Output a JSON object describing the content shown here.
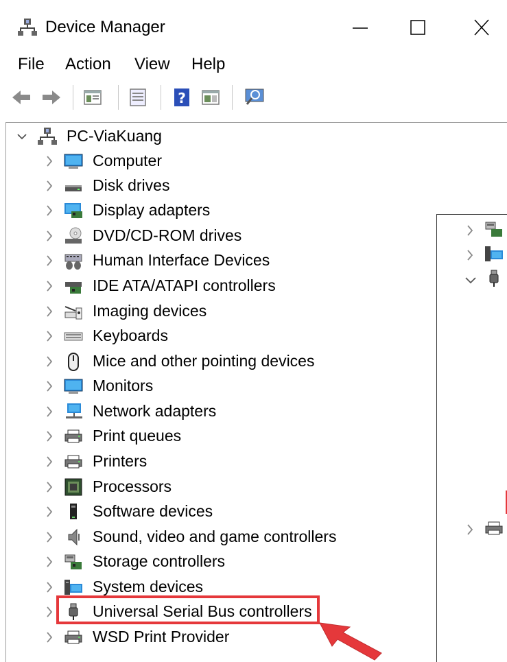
{
  "window": {
    "title": "Device Manager",
    "minimize_glyph": "—",
    "maximize_glyph": "☐",
    "close_glyph": "✕"
  },
  "menu": [
    "File",
    "Action",
    "View",
    "Help"
  ],
  "toolbar": {
    "buttons": [
      "back-icon",
      "forward-icon",
      "show-hide-console-tree-icon",
      "properties-icon",
      "help-icon",
      "action-pane-icon",
      "scan-hardware-icon"
    ]
  },
  "tree": {
    "root": {
      "label": "PC-ViaKuang",
      "icon": "computer-network-icon",
      "expanded": true
    },
    "items": [
      {
        "label": "Computer",
        "icon": "monitor-icon"
      },
      {
        "label": "Disk drives",
        "icon": "disk-drive-icon"
      },
      {
        "label": "Display adapters",
        "icon": "display-adapter-icon"
      },
      {
        "label": "DVD/CD-ROM drives",
        "icon": "dvd-drive-icon"
      },
      {
        "label": "Human Interface Devices",
        "icon": "hid-icon"
      },
      {
        "label": "IDE ATA/ATAPI controllers",
        "icon": "ide-controller-icon"
      },
      {
        "label": "Imaging devices",
        "icon": "imaging-device-icon"
      },
      {
        "label": "Keyboards",
        "icon": "keyboard-icon"
      },
      {
        "label": "Mice and other pointing devices",
        "icon": "mouse-icon"
      },
      {
        "label": "Monitors",
        "icon": "monitor-icon"
      },
      {
        "label": "Network adapters",
        "icon": "network-adapter-icon"
      },
      {
        "label": "Print queues",
        "icon": "printer-icon"
      },
      {
        "label": "Printers",
        "icon": "printer-icon"
      },
      {
        "label": "Processors",
        "icon": "processor-icon"
      },
      {
        "label": "Software devices",
        "icon": "software-device-icon"
      },
      {
        "label": "Sound, video and game controllers",
        "icon": "speaker-icon"
      },
      {
        "label": "Storage controllers",
        "icon": "storage-controller-icon"
      },
      {
        "label": "System devices",
        "icon": "system-devices-icon"
      },
      {
        "label": "Universal Serial Bus controllers",
        "icon": "usb-icon",
        "highlighted": true
      },
      {
        "label": "WSD Print Provider",
        "icon": "printer-icon"
      }
    ]
  },
  "colors": {
    "highlight_border": "#e5383b",
    "arrow": "#e5383b",
    "chevron": "#8a8a8a"
  }
}
